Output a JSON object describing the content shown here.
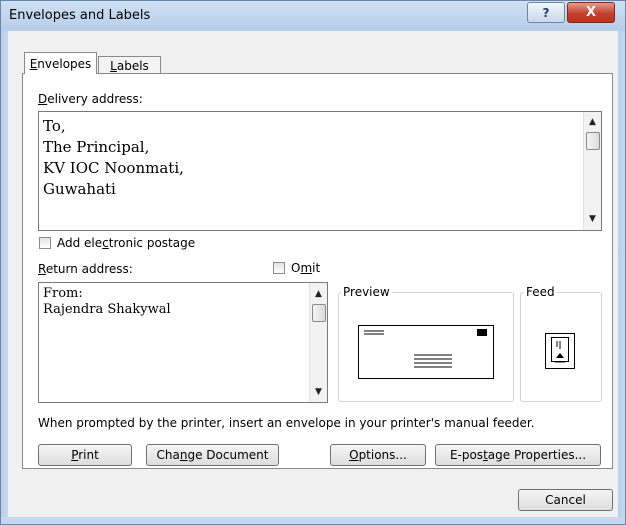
{
  "window": {
    "title": "Envelopes and Labels",
    "help_label": "?",
    "close_label": "X"
  },
  "tabs": [
    {
      "label": "Envelopes",
      "mnemonic": "E",
      "rest": "nvelopes",
      "active": true
    },
    {
      "label": "Labels",
      "mnemonic": "L",
      "rest": "abels",
      "active": false
    }
  ],
  "delivery": {
    "label_mnemonic": "D",
    "label_rest": "elivery address:",
    "lines": [
      "To,",
      "The Principal,",
      "KV IOC Noonmati,",
      "Guwahati"
    ]
  },
  "add_postage": {
    "pre": "Add ele",
    "mnemonic": "c",
    "post": "tronic postage",
    "checked": false
  },
  "return": {
    "label_mnemonic": "R",
    "label_rest": "eturn address:",
    "lines": [
      "From:",
      "Rajendra Shakywal"
    ]
  },
  "omit": {
    "pre": "O",
    "mnemonic": "m",
    "post": "it",
    "checked": false
  },
  "preview_label": "Preview",
  "feed_label": "Feed",
  "prompt_text": "When prompted by the printer, insert an envelope in your printer's manual feeder.",
  "buttons": {
    "print": {
      "mnemonic": "P",
      "rest": "rint"
    },
    "change_document": {
      "pre": "Cha",
      "mnemonic": "n",
      "post": "ge Document"
    },
    "options": {
      "mnemonic": "O",
      "rest": "ptions..."
    },
    "epostage": {
      "pre": "E-pos",
      "mnemonic": "t",
      "post": "age Properties..."
    },
    "cancel": "Cancel"
  },
  "colors": {
    "title_bar": "#bcd1ea",
    "close": "#c4412e",
    "dialog_bg": "#f0f0f0"
  }
}
